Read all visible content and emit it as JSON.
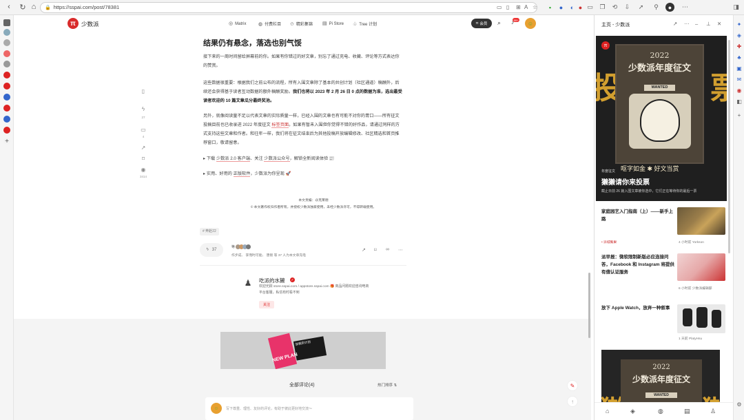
{
  "browser": {
    "url": "https://sspai.com/post/78381",
    "left_sidebar_icons": [
      "tabs-icon",
      "bookmark-icon",
      "settings-icon",
      "mail-icon",
      "user-icon",
      "red-app-icon",
      "red-app-icon",
      "blue-app-icon",
      "red-app-icon",
      "red-app-icon",
      "blue-app-icon",
      "red-app-icon",
      "add-icon"
    ]
  },
  "site": {
    "brand": "少数派",
    "nav": [
      "Matrix",
      "付费栏目",
      "精彩集锦",
      "Pi Store",
      "Tree 计划"
    ],
    "member_label": "会员",
    "bell_badge": "99+"
  },
  "article": {
    "heading": "结果仍有悬念，落选也别气馁",
    "p1": "接下来的一周时间留给屏幕前的你。如果有你错过的好文章，别忘了通过充电、收藏、评论等方式表达你的赞赏。",
    "p2_a": "这些数据很重要：根据我们之前公布的流程，所有入围文章除了基本的共创计划（社区通道）稿酬外，后续还会获得基于读者互动数据的额外稿酬奖励。",
    "p2_b": "我们也将以 2023 年 2 月 26 日 0 点的数据为准，选出最受读者欢迎的 10 篇文章瓜分最终奖池。",
    "p3_a": "另外，就像阅读量不足以代表文章的实际质量一样，已经入围的文章也有可能不对你的胃口——所有征文投稿目前也已收录进 2022 年度征文 ",
    "p3_tag": "标签页面",
    "p3_b": "。如果有暂未入围但你觉得不错的好作品，请通过同样的方式支持这些文章和作者。和往年一样，我们将在征文结束后为其他投稿开放编辑修改、社区精选和首页推荐窗口，敬请留意。",
    "b1_a": "下载 ",
    "b1_link1": "少数派 2.0 客户端",
    "b1_b": "、关注 ",
    "b1_link2": "少数派公众号",
    "b1_c": "，解锁全新阅读体验 📰",
    "b2_a": "实用、好用的 ",
    "b2_link": "正版软件",
    "b2_b": "，少数派为你呈现 🚀",
    "copy1": "本文责编：@克莱德",
    "copy2": "© 本文著作权归作者所有，并授权少数派独家使用，未经少数派许可，不得转载使用。",
    "tag": "# 奔赴22",
    "like_count": "37",
    "likers_text": "等",
    "likers_names": "作步成、 李而时可能、 唐假",
    "likers_note": "等 37 人为本文章充电",
    "float_like": "27",
    "float_comment": "4",
    "float_view": "3414"
  },
  "author": {
    "name": "吃派的水獭",
    "bio": "欢迎光顾 store.sspai.com / appstore.sspai.com 🎁 商品问题欢迎咨询电商平台客服，私信有时看不到",
    "follow_label": "关注"
  },
  "comments": {
    "title": "全部评论(4)",
    "sort": "热门排序",
    "placeholder": "写下尊重、理性、友好的评论，有助于彼此更好地交流～"
  },
  "banner": {
    "text": "加我的计划",
    "plan": "NEW PLAN"
  },
  "panel": {
    "title": "主页 - 少数派",
    "hero": {
      "year": "2022",
      "title": "少数派年度征文",
      "wanted": "WANTED",
      "slogan": "呕字如金 ✱ 好文当赏",
      "tag": "年度征文",
      "heading": "獭獭请你来投票",
      "desc": "截止日前 26 篇入围文章被你选中，它们正在等待你的最后一票",
      "big": "投",
      "big2": "票"
    },
    "articles": [
      {
        "title": "家庭园艺入门指南（上）——新手上路",
        "meta": "4 小时前",
        "author": "Yorkson",
        "tag": "• 派城鬓果"
      },
      {
        "title": "派早报：微软限制新版必应连接问答，Facebook 和 Instagram 将提供有偿认证服务",
        "meta": "6 小时前",
        "author": "少数派编辑部"
      },
      {
        "title": "放下 Apple Watch，放弃一种叙事",
        "meta": "1 天前",
        "author": "PlatyHsu"
      }
    ],
    "second": {
      "year": "2022",
      "title": "少数派年度征文",
      "wanted": "WANTED",
      "big": "獭"
    }
  }
}
